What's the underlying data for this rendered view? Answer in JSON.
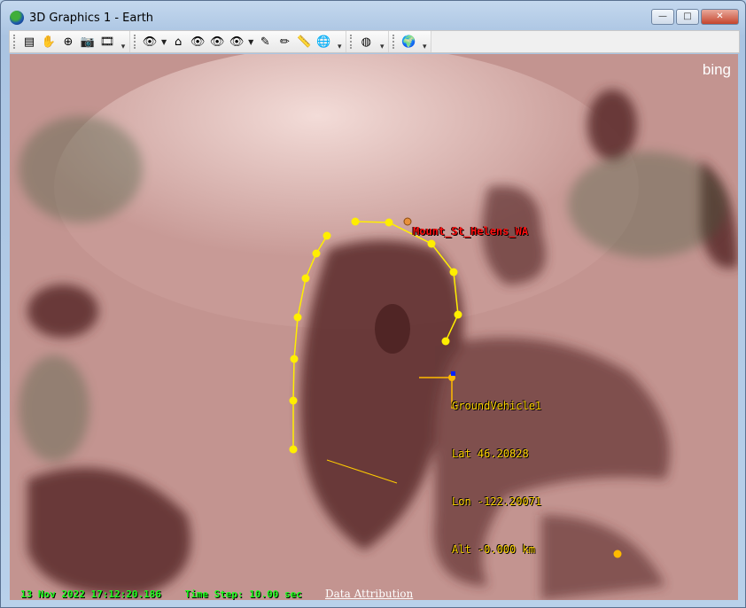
{
  "window": {
    "title": "3D Graphics 1 - Earth",
    "controls": {
      "minimize": "—",
      "maximize": "□",
      "close": "✕"
    }
  },
  "toolbar": {
    "groups": [
      [
        {
          "icon": "properties-icon",
          "g": "▤"
        },
        {
          "icon": "pan-hand-icon",
          "g": "✋"
        },
        {
          "icon": "zoom-icon",
          "g": "⊕"
        },
        {
          "icon": "snapshot-icon",
          "g": "📷"
        },
        {
          "icon": "record-movie-icon",
          "g": "🎞"
        }
      ],
      [
        {
          "icon": "view-from-icon",
          "g": "👁",
          "dd": true
        },
        {
          "icon": "home-view-icon",
          "g": "⌂"
        },
        {
          "icon": "north-up-icon",
          "g": "👁"
        },
        {
          "icon": "top-down-view-icon",
          "g": "👁"
        },
        {
          "icon": "view-to-icon",
          "g": "👁",
          "dd": true
        },
        {
          "icon": "highlighter-icon",
          "g": "✎"
        },
        {
          "icon": "pencil-icon",
          "g": "✏"
        },
        {
          "icon": "measure-icon",
          "g": "📏"
        },
        {
          "icon": "globe-menu-icon",
          "g": "🌐"
        }
      ],
      [
        {
          "icon": "disabled-globe-icon",
          "g": "◍"
        }
      ],
      [
        {
          "icon": "globe-download-icon",
          "g": "🌍"
        }
      ]
    ]
  },
  "map": {
    "logo": "bing",
    "place_label": "Mount_St_Helens_WA",
    "vehicle": {
      "name": "GroundVehicle1",
      "lat": "Lat 46.20828",
      "lon": "Lon -122.20071",
      "alt": "Alt -0.000 km"
    },
    "colors": {
      "route": "#ffee00",
      "vehicle_label": "#ffd400",
      "place_label": "#ff1010",
      "status": "#1eff1e"
    }
  },
  "status": {
    "datetime": "13 Nov 2022 17:12:20.186",
    "time_step": "Time Step: 10.00 sec",
    "attribution": "Data Attribution"
  }
}
